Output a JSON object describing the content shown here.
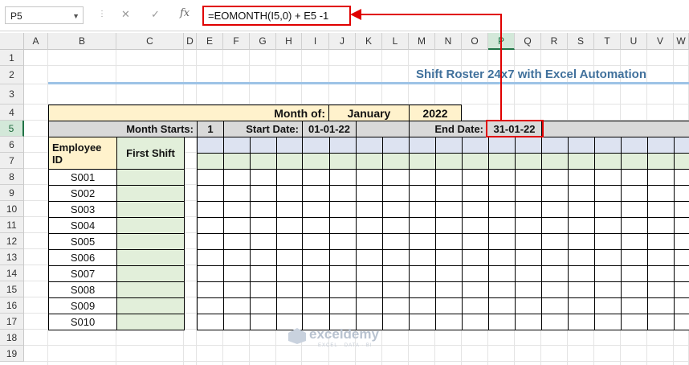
{
  "formula_bar": {
    "name_box": "P5",
    "cancel_icon": "✕",
    "enter_icon": "✓",
    "fx_label": "fx",
    "formula": "=EOMONTH(I5,0) + E5 -1"
  },
  "columns": [
    "A",
    "B",
    "C",
    "D",
    "E",
    "F",
    "G",
    "H",
    "I",
    "J",
    "K",
    "L",
    "M",
    "N",
    "O",
    "P",
    "Q",
    "R",
    "S",
    "T",
    "U",
    "V",
    "W"
  ],
  "rows": [
    "1",
    "2",
    "3",
    "4",
    "5",
    "6",
    "7",
    "8",
    "9",
    "10",
    "11",
    "12",
    "13",
    "14",
    "15",
    "16",
    "17",
    "18",
    "19"
  ],
  "selected_column": "P",
  "selected_row": "5",
  "sheet": {
    "title": "Shift Roster 24x7  with Excel Automation",
    "month_of_label": "Month of:",
    "month_value": "January",
    "year_value": "2022",
    "month_starts_label": "Month Starts:",
    "month_starts_value": "1",
    "start_date_label": "Start Date:",
    "start_date_value": "01-01-22",
    "end_date_label": "End Date:",
    "end_date_value": "31-01-22",
    "employee_id_header": "Employee ID",
    "first_shift_header": "First Shift",
    "employees": [
      "S001",
      "S002",
      "S003",
      "S004",
      "S005",
      "S006",
      "S007",
      "S008",
      "S009",
      "S010"
    ]
  },
  "watermark": {
    "name": "exceldemy",
    "tagline": "EXCEL · DATA · BI"
  },
  "colors": {
    "header_yellow": "#fff2cc",
    "header_grey": "#d9d9d9",
    "first_shift_green": "#e2efda",
    "row6_blue": "#dde3f1",
    "row7_green": "#e2efda",
    "highlight_red": "#e00000",
    "title_blue": "#41719c"
  }
}
